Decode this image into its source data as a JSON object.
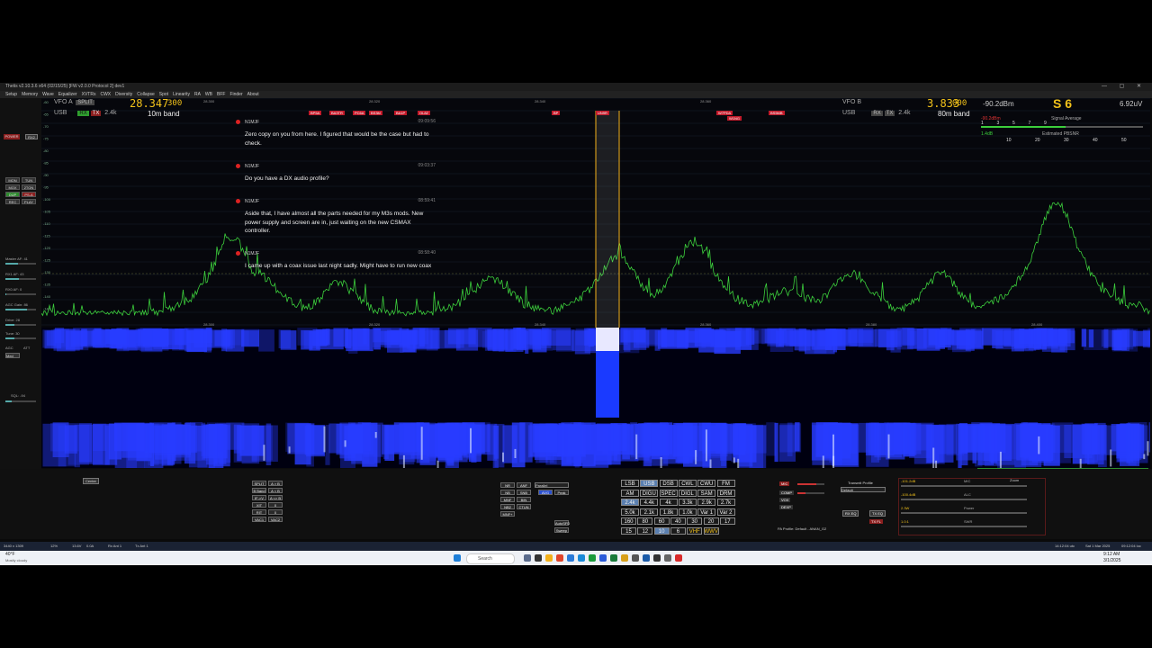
{
  "app": {
    "title": "Thetis v2.10.3.6 x64 (02/15/25) [FW v2.0.0 Protocol 2] dev1",
    "window_controls": "— ▢ ✕"
  },
  "menu": [
    "Setup",
    "Memory",
    "Wave",
    "Equalizer",
    "XVTRs",
    "CWX",
    "Diversity",
    "Collapse",
    "Spot",
    "Linearity",
    "RA",
    "WB",
    "BFF",
    "Finder",
    "About"
  ],
  "vfoA": {
    "label": "VFO A",
    "split": "SPLIT",
    "mode": "USB",
    "rx": "RX",
    "tx": "TX",
    "filter": "2.4k",
    "freq": "28.347",
    "freq_sub": "300",
    "band": "10m band"
  },
  "vfoB": {
    "label": "VFO B",
    "mode": "USB",
    "rx": "RX",
    "tx": "TX",
    "filter": "2.4k",
    "freq": "3.833",
    "freq_sub": "000",
    "band": "80m band"
  },
  "meter": {
    "dbm": "-90.2dBm",
    "s": "S 6",
    "uv": "6.92uV",
    "sub1": "-90.2dBm",
    "sub2": "Signal Average",
    "pbsnr": "1.4dB",
    "pbsnr_label": "Estimated PBSNR",
    "scale": [
      "1",
      "3",
      "5",
      "7",
      "9",
      "10",
      "20",
      "30",
      "40",
      "50"
    ]
  },
  "left": {
    "power": "POWER",
    "rx2": "RX2",
    "buttons": [
      "MON",
      "TUN",
      "MOX",
      "2TON",
      "DUP",
      "PS-A",
      "REC",
      "PLAY"
    ],
    "master_af": "Master AF: 41",
    "rx1_af": "RX1 AF: 43",
    "rx0_af": "RX0 AF: 0",
    "agc_gain": "AGC Gain: 86",
    "drive": "Drive: 28",
    "tune": "Tune: 30",
    "agc": "AGC",
    "att": "ATT",
    "agc_val": "Med",
    "sql": "SQL: -94"
  },
  "spots": [
    "BP5A",
    "BA3TR",
    "PC6A",
    "BS3M",
    "BA1P",
    "OL8Z",
    "BP",
    "UN9R",
    "W7PDA",
    "W1NG",
    "BS5MB"
  ],
  "freq_ticks_top": [
    "28.300",
    "28.320",
    "28.340",
    "28.360"
  ],
  "freq_ticks_bottom": [
    "28.300",
    "28.320",
    "28.340",
    "28.360",
    "28.380",
    "28.400"
  ],
  "db_scale": [
    "-60",
    "-65",
    "-70",
    "-75",
    "-80",
    "-85",
    "-90",
    "-95",
    "-100",
    "-105",
    "-110",
    "-115",
    "-120",
    "-125",
    "-130",
    "-135",
    "-140",
    "-145"
  ],
  "chat": [
    {
      "who": "N1MJF",
      "time": "09:09:56",
      "text": "Zero copy on you from here. I figured that would be the case but had to check."
    },
    {
      "who": "N1MJF",
      "time": "09:03:37",
      "text": "Do you have a DX audio profile?"
    },
    {
      "who": "N1MJF",
      "time": "08:59:41",
      "text": "Aside that, I have almost all the parts needed for my M3s mods. New power supply and screen are in, just waiting on the new CSMAX controller."
    },
    {
      "who": "N1MJF",
      "time": "08:58:40",
      "text": "I came up with a coax issue last night sadly. Might have to run new coax out to the antenna. Over about 400w SWR suddenly"
    }
  ],
  "display_row": {
    "slide": "Slide",
    "peak": "Peak",
    "center": "Center",
    "zoom": "Zoom",
    "feedback": "Feedback",
    "pure": "Pure Signal2"
  },
  "bottom": {
    "split_btns": [
      "SPLIT",
      "A > B",
      "B Band",
      "A < B",
      "IF->V",
      "A <> B",
      "XIT",
      "0",
      "RIT",
      "0",
      "VAC1",
      "VAC2"
    ],
    "dsp_btns": [
      "NR",
      "ANF",
      "NB",
      "SNB",
      "MNF",
      "BIN",
      "NB2",
      "CTUN",
      "MNF+",
      "AVG",
      "Peak",
      "Sweep",
      "AutoSFD"
    ],
    "dsp_select": "Parallel",
    "modes": [
      "LSB",
      "USB",
      "DSB",
      "CWL",
      "CWU",
      "FM",
      "AM",
      "DIGU",
      "SPEC",
      "DIGL",
      "SAM",
      "DRM"
    ],
    "filters": [
      "2.4k",
      "4.4k",
      "4k",
      "3.3k",
      "2.9k",
      "2.7k",
      "5.0k",
      "2.1k",
      "1.8k",
      "1.0k",
      "Var 1",
      "Var 2"
    ],
    "bands": [
      "160",
      "80",
      "60",
      "40",
      "30",
      "20",
      "17",
      "15",
      "12",
      "10",
      "6",
      "VHF",
      "WWV"
    ],
    "mic": "MIC",
    "comp": "COMP",
    "vox": "VOX",
    "dexp": "DEXP",
    "transmit_profile": "Transmit Profile",
    "profile_name": "Default",
    "rx_eq": "RX EQ",
    "tx_eq": "TX EQ",
    "txfl": "TX FL",
    "pa_profile": "PA Profile: Default - ANAN_G2",
    "meter2_labels": [
      "MIC",
      "ALC",
      "Power",
      "SWR"
    ],
    "meter2_vals": [
      "-101.2dB",
      "-100.4dB",
      "2.3W",
      "1.0:1"
    ]
  },
  "status": {
    "left": "3440 x 1309",
    "cpu": "12%",
    "volts": "13.6V",
    "amps": "0.0A",
    "rx": "Rx Ant 1",
    "tx": "Tx Ant 1",
    "time_utc": "14:12:04 utc",
    "date": "Sat 1 Mar 2025",
    "local": "09:12:04 loc"
  },
  "taskbar": {
    "search": "Search",
    "weather": "40°F",
    "weather_sub": "Mostly cloudy",
    "clock": "9:12 AM",
    "date": "3/1/2025"
  },
  "colors": {
    "accent": "#f2c21a",
    "spectrum": "#3ccf3c",
    "waterfall": "#1a3aff",
    "spot": "#c21a2a"
  }
}
